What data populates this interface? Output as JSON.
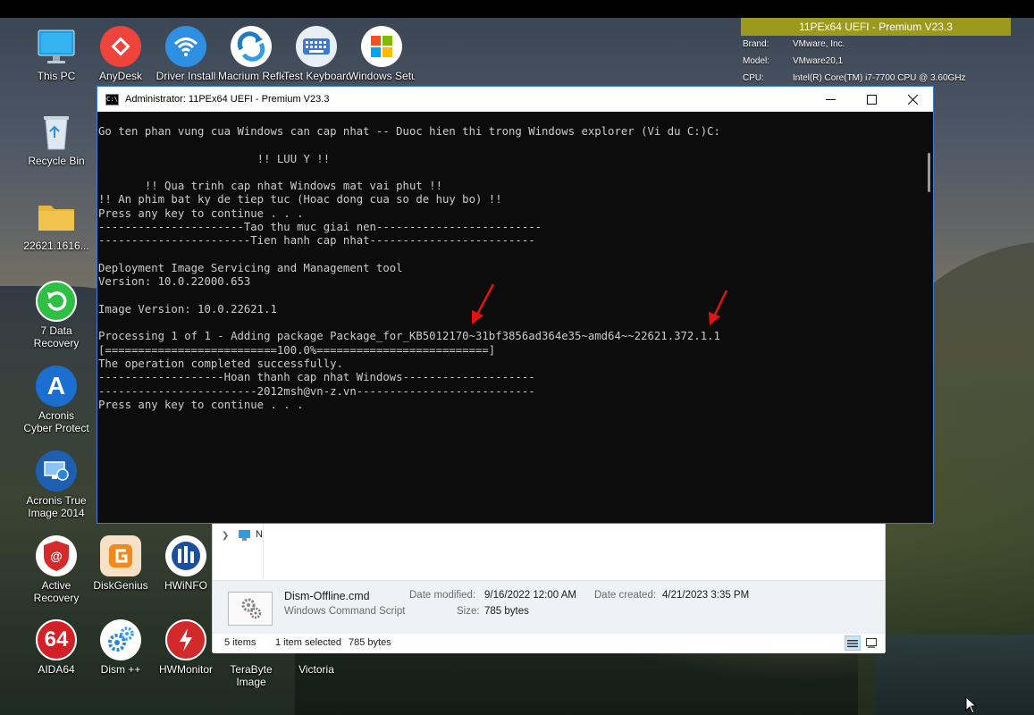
{
  "system_info": {
    "header": "11PEx64 UEFI - Premium V23.3",
    "rows": [
      {
        "key": "Brand:",
        "value": "VMware, Inc."
      },
      {
        "key": "Model:",
        "value": "VMware20,1"
      },
      {
        "key": "CPU:",
        "value": "Intel(R) Core(TM) i7-7700 CPU @ 3.60GHz"
      }
    ]
  },
  "desktop_icons": [
    {
      "label": "This PC",
      "icon": "monitor-icon"
    },
    {
      "label": "AnyDesk",
      "icon": "anydesk-icon",
      "color": "#ef443b"
    },
    {
      "label": "Driver Install",
      "icon": "wifi-icon",
      "color": "#2f8fe0"
    },
    {
      "label": "Macrium Reflect",
      "icon": "macrium-icon",
      "color": "#1f7ac8"
    },
    {
      "label": "Test Keyboard",
      "icon": "keyboard-icon",
      "color": "#3a78d8"
    },
    {
      "label": "Windows Setup",
      "icon": "windows-logo-icon"
    },
    {
      "label": "Recycle Bin",
      "icon": "recycle-bin-icon"
    },
    {
      "label": "22621.1616...",
      "icon": "folder-icon",
      "color": "#f3c44b"
    },
    {
      "label": "7 Data Recovery",
      "icon": "data-recovery-icon",
      "color": "#2fbf44"
    },
    {
      "label": "Acronis Cyber Protect",
      "icon": "acronis-icon",
      "color": "#1b6fd1"
    },
    {
      "label": "Acronis True Image 2014",
      "icon": "acronis-true-image-icon",
      "color": "#1d5fb0"
    },
    {
      "label": "Active Recovery",
      "icon": "active-recovery-icon",
      "color": "#d42a2a"
    },
    {
      "label": "DiskGenius",
      "icon": "diskgenius-icon",
      "color": "#f08a1e"
    },
    {
      "label": "HWiNFO",
      "icon": "hwinfo-icon",
      "color": "#1a4f9c"
    },
    {
      "label": "AIDA64",
      "icon": "aida64-icon",
      "glyph": "64",
      "color": "#d41f26"
    },
    {
      "label": "Dism ++",
      "icon": "gears-icon",
      "color": "#2a86d8"
    },
    {
      "label": "HWMonitor",
      "icon": "hwmonitor-icon",
      "color": "#d22a2a"
    },
    {
      "label": "TeraByte Image",
      "icon": "terabyte-icon"
    },
    {
      "label": "Victoria",
      "icon": "victoria-icon"
    }
  ],
  "console": {
    "title": "Administrator:  11PEx64 UEFI - Premium V23.3",
    "icon_text": "C:\\",
    "lines": [
      "Go ten phan vung cua Windows can cap nhat -- Duoc hien thi trong Windows explorer (Vi du C:)C:",
      "",
      "                        !! LUU Y !!",
      "",
      "       !! Qua trinh cap nhat Windows mat vai phut !!",
      "!! An phim bat ky de tiep tuc (Hoac dong cua so de huy bo) !!",
      "Press any key to continue . . .",
      "----------------------Tao thu muc giai nen-------------------------",
      "-----------------------Tien hanh cap nhat-------------------------",
      "",
      "Deployment Image Servicing and Management tool",
      "Version: 10.0.22000.653",
      "",
      "Image Version: 10.0.22621.1",
      "",
      "Processing 1 of 1 - Adding package Package_for_KB5012170~31bf3856ad364e35~amd64~~22621.372.1.1",
      "[==========================100.0%==========================]",
      "The operation completed successfully.",
      "-------------------Hoan thanh cap nhat Windows--------------------",
      "------------------------2012msh@vn-z.vn---------------------------",
      "Press any key to continue . . ."
    ]
  },
  "explorer": {
    "nav_item": "N",
    "file": {
      "name": "Dism-Offline.cmd",
      "type": "Windows Command Script",
      "date_modified_label": "Date modified:",
      "date_modified": "9/16/2022 12:00 AM",
      "date_created_label": "Date created:",
      "date_created": "4/21/2023 3:35 PM",
      "size_label": "Size:",
      "size": "785 bytes"
    },
    "status": {
      "items": "5 items",
      "selected": "1 item selected",
      "selected_size": "785 bytes"
    }
  },
  "annotation_color": "#e01414"
}
